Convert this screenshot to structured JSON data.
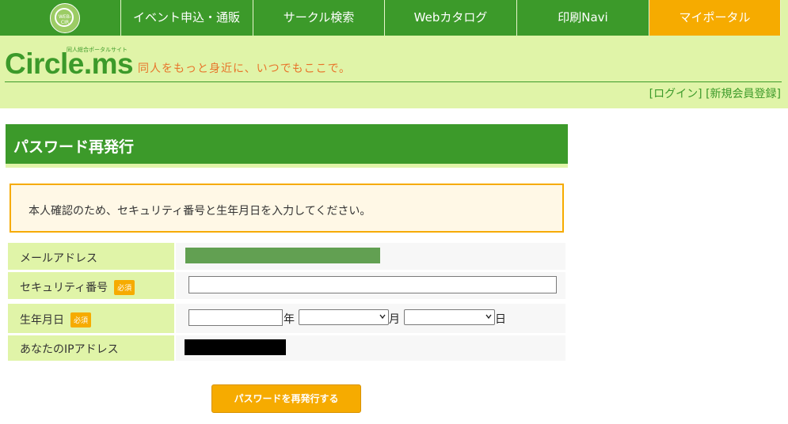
{
  "nav": {
    "logo_text": "WEB-CIR",
    "items": [
      {
        "label": "イベント申込・通販"
      },
      {
        "label": "サークル検索"
      },
      {
        "label": "Webカタログ"
      },
      {
        "label": "印刷Navi"
      },
      {
        "label": "マイポータル"
      }
    ],
    "active_index": 4
  },
  "header": {
    "brand": "Circle.ms",
    "brand_sub": "同人総合ポータルサイト",
    "tagline": "同人をもっと身近に、いつでもここで。",
    "login_link": "[ログイン]",
    "register_link": "[新規会員登録]"
  },
  "page": {
    "title": "パスワード再発行",
    "notice": "本人確認のため、セキュリティ番号と生年月日を入力してください。"
  },
  "form": {
    "email_label": "メールアドレス",
    "security_label": "セキュリティ番号",
    "security_value": "",
    "birthdate_label": "生年月日",
    "year_value": "",
    "year_unit": "年",
    "month_value": "",
    "month_unit": "月",
    "day_value": "",
    "day_unit": "日",
    "ip_label": "あなたのIPアドレス",
    "required_badge": "必須",
    "submit_label": "パスワードを再発行する"
  },
  "colors": {
    "brand_green": "#3c9a2a",
    "light_green": "#e0f4a8",
    "accent_orange": "#f6ab00",
    "tagline_orange": "#e8742a"
  }
}
